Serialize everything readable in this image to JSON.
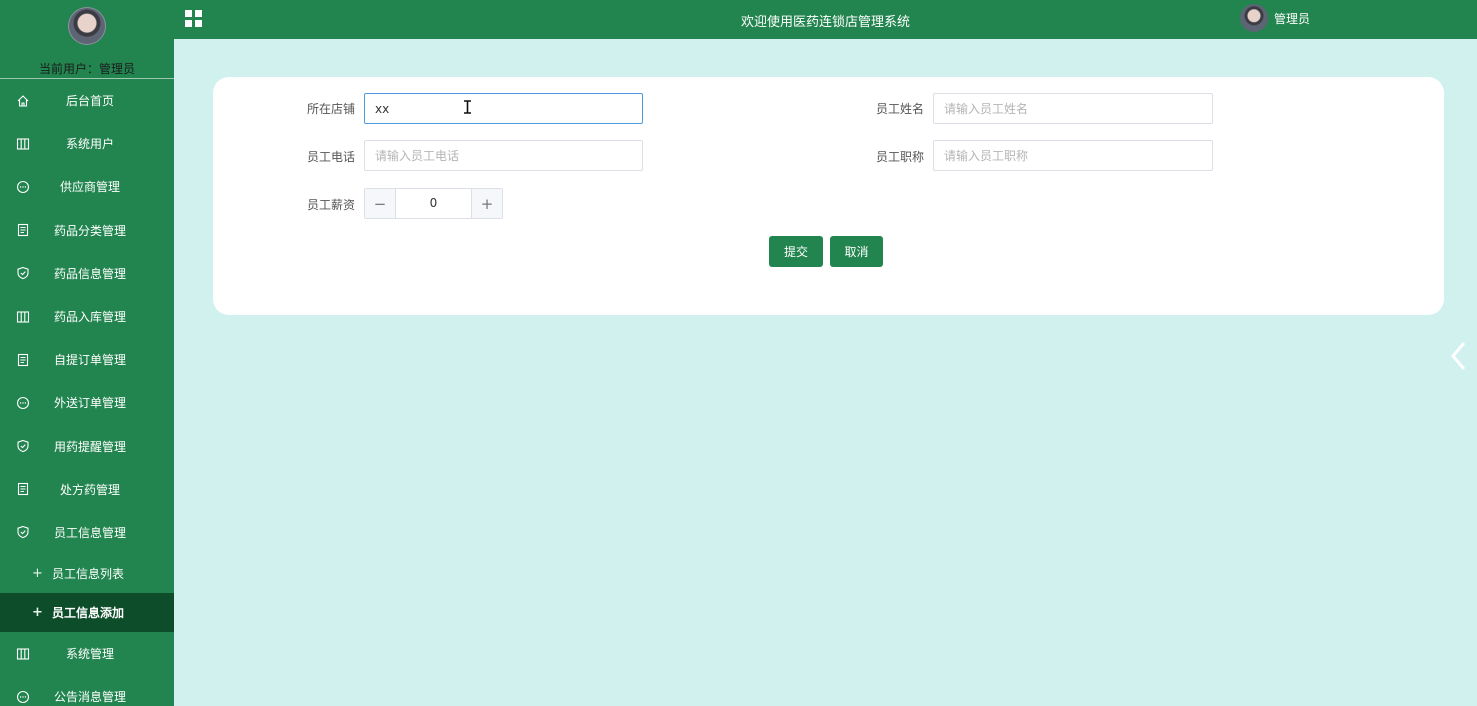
{
  "sidebar": {
    "current_user_label": "当前用户：",
    "current_user_name": "管理员",
    "menu_icons": [
      "home-icon",
      "columns-icon",
      "chat-icon",
      "document-icon",
      "shield-icon",
      "columns-icon",
      "document-icon",
      "chat-icon",
      "shield-icon",
      "document-icon",
      "shield-icon",
      "columns-icon",
      "chat-icon"
    ],
    "items": [
      {
        "label": "后台首页",
        "icon": "home-icon"
      },
      {
        "label": "系统用户",
        "icon": "columns-icon"
      },
      {
        "label": "供应商管理",
        "icon": "chat-icon"
      },
      {
        "label": "药品分类管理",
        "icon": "document-icon"
      },
      {
        "label": "药品信息管理",
        "icon": "shield-icon"
      },
      {
        "label": "药品入库管理",
        "icon": "columns-icon"
      },
      {
        "label": "自提订单管理",
        "icon": "document-icon"
      },
      {
        "label": "外送订单管理",
        "icon": "chat-icon"
      },
      {
        "label": "用药提醒管理",
        "icon": "shield-icon"
      },
      {
        "label": "处方药管理",
        "icon": "document-icon"
      },
      {
        "label": "员工信息管理",
        "icon": "shield-icon"
      }
    ],
    "sub_items": [
      {
        "label": "员工信息列表",
        "active": false
      },
      {
        "label": "员工信息添加",
        "active": true
      }
    ],
    "items_after": [
      {
        "label": "系统管理",
        "icon": "columns-icon"
      },
      {
        "label": "公告消息管理",
        "icon": "chat-icon"
      }
    ]
  },
  "header": {
    "title": "欢迎使用医药连锁店管理系统",
    "user_name": "管理员"
  },
  "form": {
    "store_label": "所在店铺",
    "store_value": "xx",
    "name_label": "员工姓名",
    "name_placeholder": "请输入员工姓名",
    "phone_label": "员工电话",
    "phone_placeholder": "请输入员工电话",
    "title_label": "员工职称",
    "title_placeholder": "请输入员工职称",
    "salary_label": "员工薪资",
    "salary_value": "0",
    "submit_label": "提交",
    "cancel_label": "取消"
  },
  "colors": {
    "primary": "#22854f",
    "active_menu": "#0d4d2a",
    "background": "#d1f1ef",
    "focus_border": "#4d9be0"
  }
}
